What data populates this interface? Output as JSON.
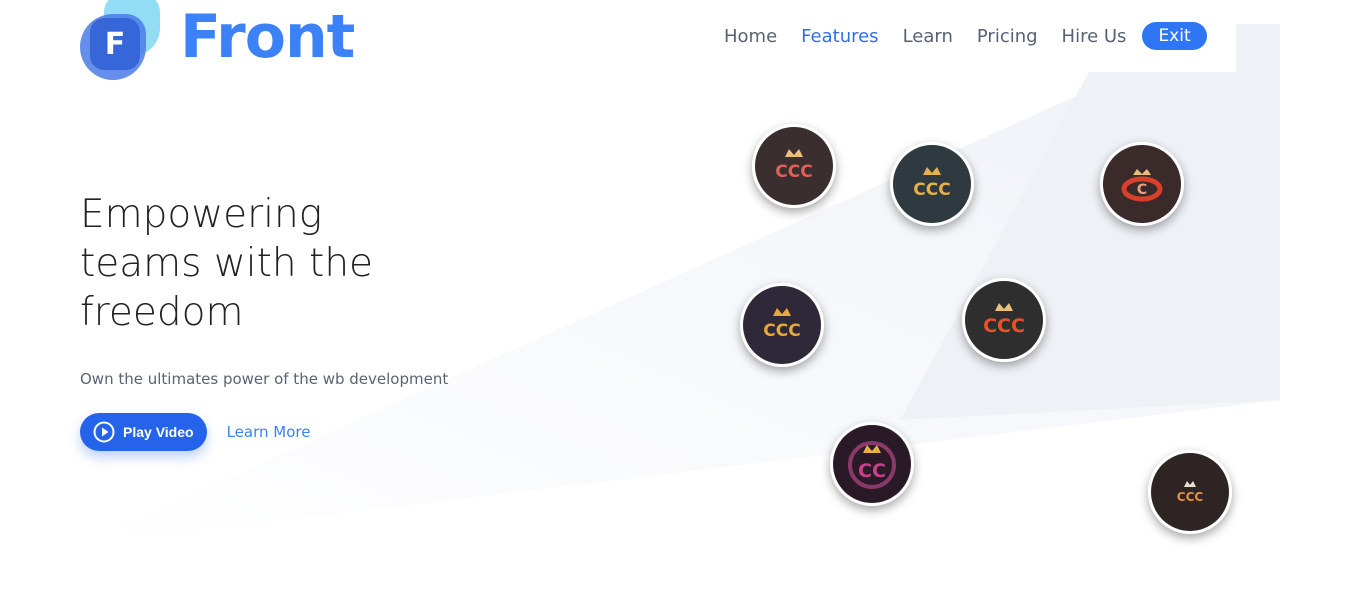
{
  "brand": {
    "name": "Front",
    "mark_letter": "F"
  },
  "nav": {
    "items": [
      {
        "label": "Home",
        "active": false
      },
      {
        "label": "Features",
        "active": true
      },
      {
        "label": "Learn",
        "active": false
      },
      {
        "label": "Pricing",
        "active": false
      },
      {
        "label": "Hire Us",
        "active": false
      }
    ],
    "exit_label": "Exit"
  },
  "hero": {
    "headline_lines": [
      "Empowering",
      "teams with the",
      "freedom"
    ],
    "subtitle": "Own the ultimates power of the wb development",
    "play_label": "Play Video",
    "learn_more_label": "Learn More"
  },
  "avatars": [
    {
      "name": "avatar-ccc-red-crown",
      "text": "CCC",
      "bg": "#3a2e2e",
      "fg": "#e0605a"
    },
    {
      "name": "avatar-ccc-gold-crown",
      "text": "CCC",
      "bg": "#2e3a40",
      "fg": "#e8b04a"
    },
    {
      "name": "avatar-c-swirl",
      "text": "C",
      "bg": "#3a2a2a",
      "fg": "#d8402a"
    },
    {
      "name": "avatar-ccc-gold",
      "text": "CCC",
      "bg": "#2e2838",
      "fg": "#e8a83a"
    },
    {
      "name": "avatar-ccc-fire",
      "text": "CCC",
      "bg": "#2e2e2e",
      "fg": "#e8502a"
    },
    {
      "name": "avatar-ccc-ornate",
      "text": "CC",
      "bg": "#2a1a28",
      "fg": "#c8408a"
    },
    {
      "name": "avatar-ccc-small",
      "text": "CCC",
      "bg": "#2e2424",
      "fg": "#e89040"
    }
  ],
  "colors": {
    "accent": "#2f76f5",
    "text": "#586275",
    "heading": "#222222"
  }
}
